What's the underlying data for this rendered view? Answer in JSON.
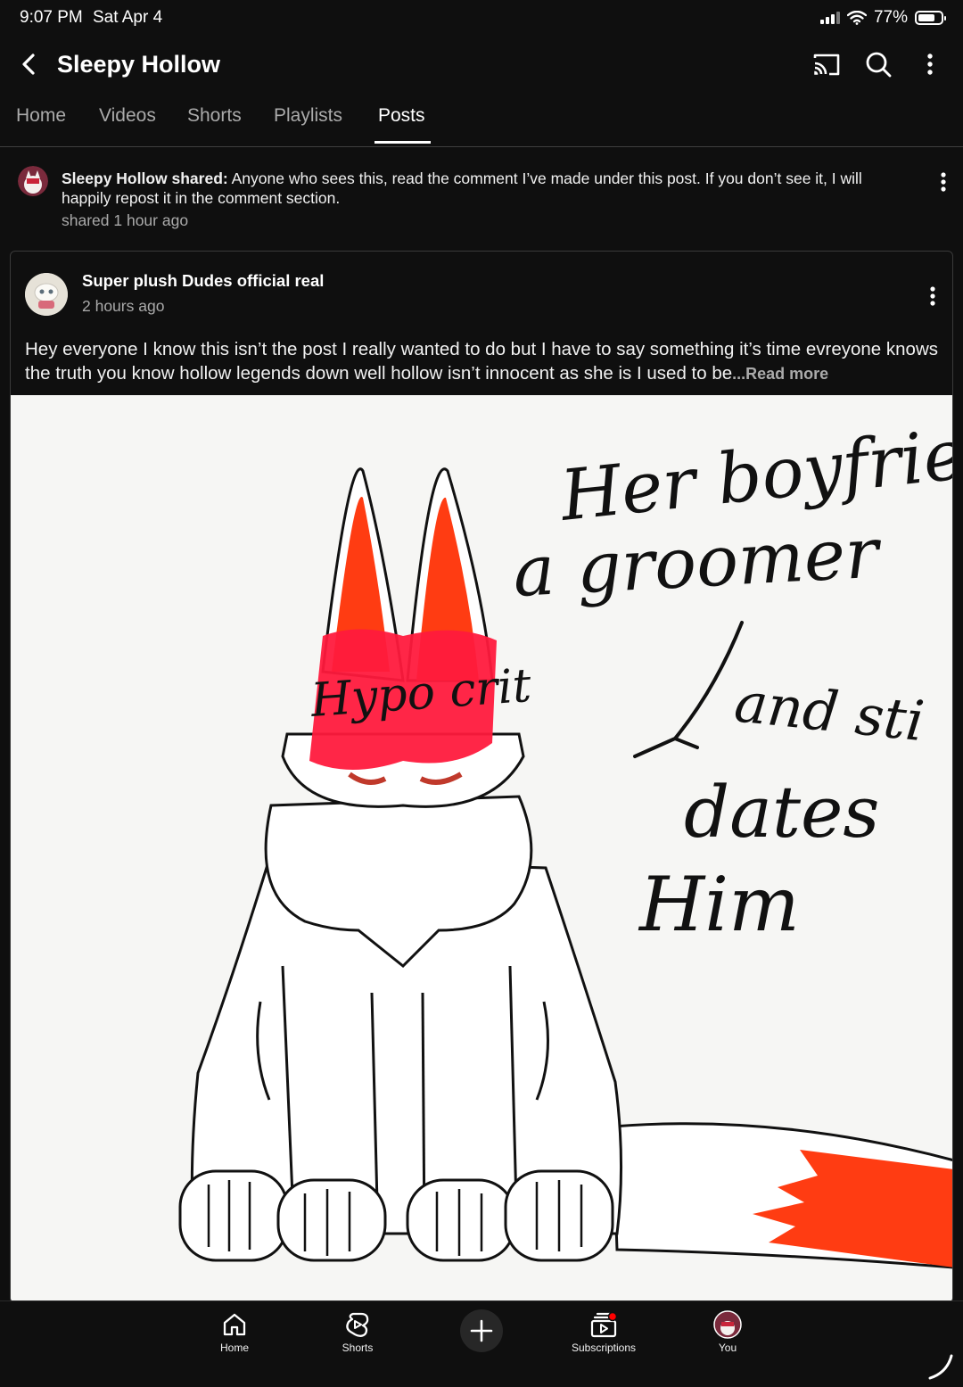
{
  "status_bar": {
    "time": "9:07 PM",
    "date": "Sat Apr 4",
    "battery": "77%",
    "battery_level": 0.77
  },
  "app_bar": {
    "title": "Sleepy Hollow"
  },
  "tabs": [
    {
      "label": "Home"
    },
    {
      "label": "Videos"
    },
    {
      "label": "Shorts"
    },
    {
      "label": "Playlists"
    },
    {
      "label": "Posts",
      "active": true
    }
  ],
  "shared": {
    "author_label": "Sleepy Hollow shared:",
    "text": "Anyone who sees this, read the comment I’ve made under this post. If you don’t see it, I will happily repost it in the comment section.",
    "time": "shared 1 hour ago"
  },
  "post": {
    "author": "Super plush Dudes official real",
    "time": "2 hours ago",
    "body": "Hey everyone I know this isn’t the post I really wanted to do but I have to say something it’s time evreyone knows the truth you know hollow legends down well hollow isn’t innocent as she is I used to be",
    "ellipsis": "...",
    "read_more": "Read more",
    "image_text": {
      "line1": "Her boyfrie",
      "line2": "a groomer",
      "line3": "and sti",
      "line4": "dates",
      "line5": "Him",
      "scribble": "Hypo crit"
    }
  },
  "bottom_nav": {
    "home": "Home",
    "shorts": "Shorts",
    "subscriptions": "Subscriptions",
    "you": "You"
  },
  "icons": [
    "back-icon",
    "cast-icon",
    "search-icon",
    "more-vert-icon",
    "home-icon",
    "shorts-icon",
    "create-icon",
    "subscriptions-icon"
  ],
  "colors": {
    "background": "#0f0f0f",
    "accent_red": "#ff0000",
    "ear_orange": "#ff3c12"
  }
}
